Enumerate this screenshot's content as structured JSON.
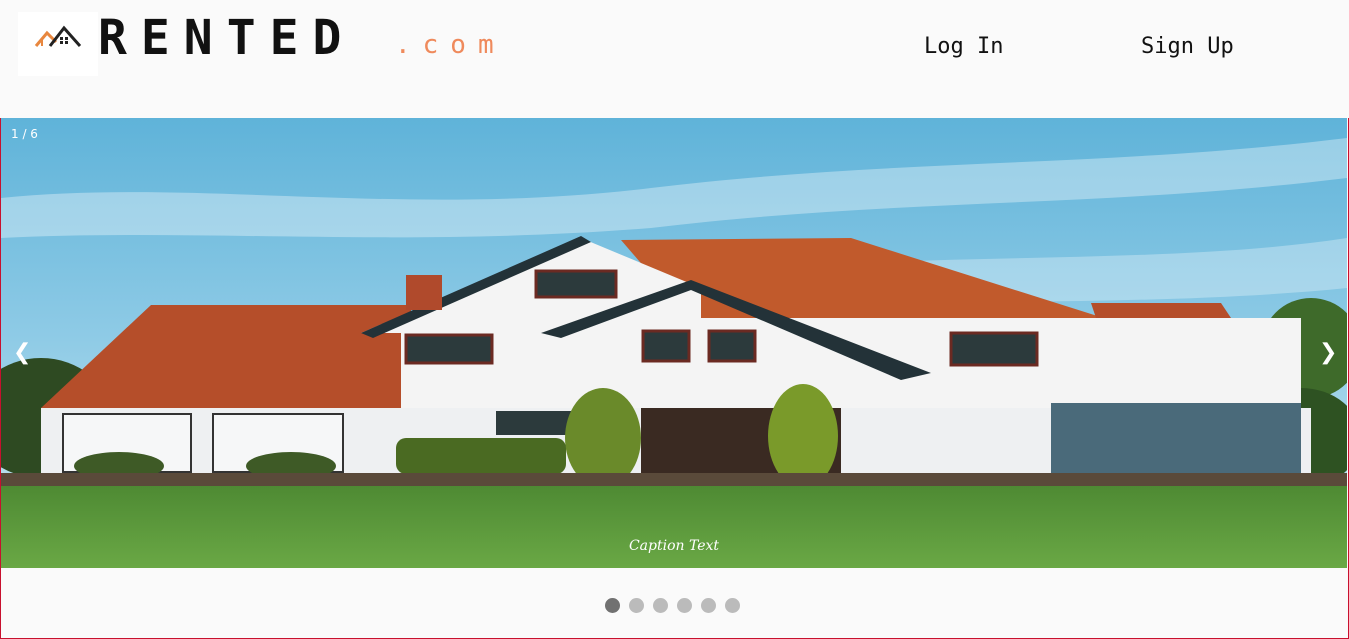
{
  "header": {
    "brand_name": "RENTED",
    "brand_suffix": ".com",
    "login_label": "Log In",
    "signup_label": "Sign Up"
  },
  "slideshow": {
    "counter": "1 / 6",
    "prev_label": "❮",
    "next_label": "❯",
    "caption": "Caption Text",
    "total_slides": 6,
    "active_slide": 1
  },
  "colors": {
    "brand_accent": "#ef8a5c",
    "frame_border": "#c8102e",
    "dot_active": "#717171",
    "dot_inactive": "#bbbbbb"
  },
  "icons": {
    "logo": "house-roof-icon"
  }
}
